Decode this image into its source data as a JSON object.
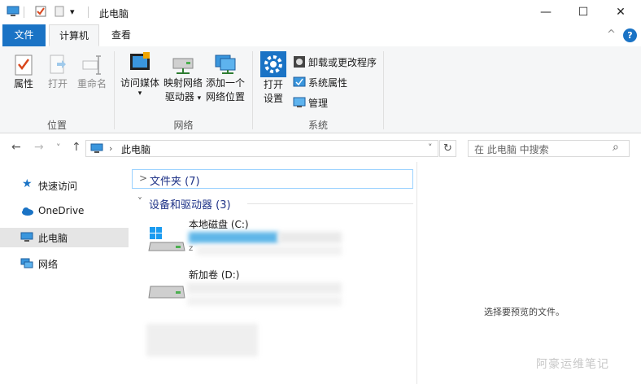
{
  "window": {
    "title": "此电脑",
    "min_glyph": "—",
    "max_glyph": "☐",
    "close_glyph": "✕"
  },
  "quick_access_dropdown_glyph": "▾",
  "ribbon_tabs": {
    "file": "文件",
    "computer": "计算机",
    "view": "查看"
  },
  "ribbon_right": {
    "collapse_glyph": "^",
    "help_glyph": "?"
  },
  "ribbon": {
    "location": {
      "properties": "属性",
      "open": "打开",
      "rename": "重命名",
      "group": "位置"
    },
    "network": {
      "access_media": "访问媒体",
      "map_drive_line1": "映射网络",
      "map_drive_line2": "驱动器",
      "add_location_line1": "添加一个",
      "add_location_line2": "网络位置",
      "dropdown_glyph": "▾",
      "group": "网络"
    },
    "system": {
      "open_settings_line1": "打开",
      "open_settings_line2": "设置",
      "uninstall": "卸载或更改程序",
      "system_properties": "系统属性",
      "manage": "管理",
      "group": "系统"
    }
  },
  "address": {
    "back": "←",
    "forward": "→",
    "recent": "˅",
    "up": "↑",
    "path": "此电脑",
    "dropdown": "˅",
    "refresh": "↻",
    "search_placeholder": "在 此电脑 中搜索",
    "search_glyph": "⌕"
  },
  "nav": {
    "quick_access": "快速访问",
    "onedrive": "OneDrive",
    "this_pc": "此电脑",
    "network": "网络"
  },
  "content": {
    "folders_header": "文件夹 (7)",
    "folders_chevron": ">",
    "devices_header": "设备和驱动器 (3)",
    "devices_chevron": "˅",
    "drive_c": "本地磁盘 (C:)",
    "drive_d": "新加卷 (D:)",
    "drive_c_extra": "z"
  },
  "preview_text": "选择要预览的文件。",
  "watermark": "阿豪运维笔记",
  "colors": {
    "accent": "#1a73c5",
    "header": "#1e3287"
  }
}
